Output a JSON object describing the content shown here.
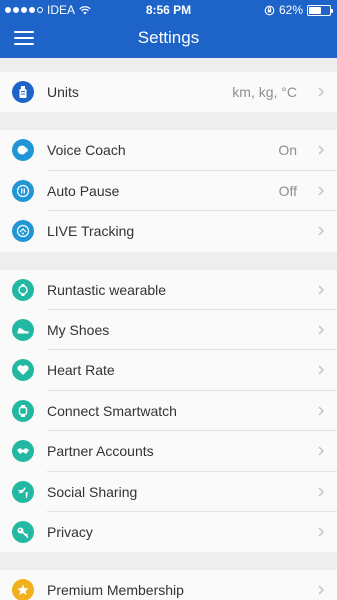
{
  "status_bar": {
    "carrier": "IDEA",
    "time": "8:56 PM",
    "battery": "62%",
    "battery_level": 0.62,
    "signal_bars_filled": 4,
    "signal_bars_total": 5
  },
  "nav": {
    "title": "Settings",
    "menu_icon": "hamburger-icon"
  },
  "groups": [
    [
      {
        "label": "Units",
        "value": "km, kg, °C",
        "icon": "units-icon"
      }
    ],
    [
      {
        "label": "Voice Coach",
        "value": "On",
        "icon": "voice-coach-icon"
      },
      {
        "label": "Auto Pause",
        "value": "Off",
        "icon": "pause-icon"
      },
      {
        "label": "LIVE Tracking",
        "value": "",
        "icon": "live-tracking-icon"
      }
    ],
    [
      {
        "label": "Runtastic wearable",
        "value": "",
        "icon": "wearable-icon"
      },
      {
        "label": "My Shoes",
        "value": "",
        "icon": "shoe-icon"
      },
      {
        "label": "Heart Rate",
        "value": "",
        "icon": "heart-icon"
      },
      {
        "label": "Connect Smartwatch",
        "value": "",
        "icon": "smartwatch-icon"
      },
      {
        "label": "Partner Accounts",
        "value": "",
        "icon": "handshake-icon"
      },
      {
        "label": "Social Sharing",
        "value": "",
        "icon": "social-icon"
      },
      {
        "label": "Privacy",
        "value": "",
        "icon": "key-icon"
      }
    ],
    [
      {
        "label": "Premium Membership",
        "value": "",
        "icon": "star-icon"
      }
    ]
  ],
  "colors": {
    "brand_blue": "#1e64c8",
    "light_blue": "#2196d6",
    "teal": "#22b8a2",
    "gold": "#f0b11c"
  }
}
